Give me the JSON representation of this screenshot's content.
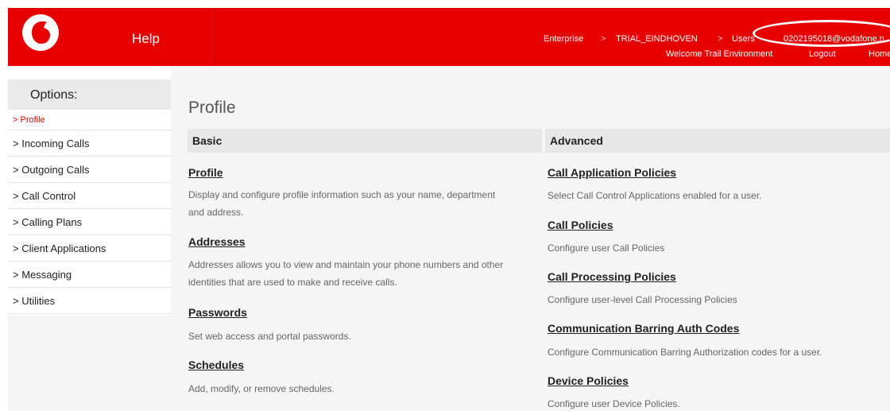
{
  "header": {
    "app_name": "Help",
    "breadcrumb": [
      "Enterprise",
      "TRIAL_EINDHOVEN",
      "Users",
      "0202195018@vodafone.n"
    ],
    "breadcrumb_sep": ">",
    "welcome": "Welcome Trail Environment",
    "logout": "Logout",
    "home": "Home",
    "brand_color": "#e60000"
  },
  "sidebar": {
    "title": "Options:",
    "items": [
      {
        "label": "> Profile",
        "active": true
      },
      {
        "label": "> Incoming Calls"
      },
      {
        "label": "> Outgoing Calls"
      },
      {
        "label": "> Call Control"
      },
      {
        "label": "> Calling Plans"
      },
      {
        "label": "> Client Applications"
      },
      {
        "label": "> Messaging"
      },
      {
        "label": "> Utilities"
      }
    ]
  },
  "main": {
    "title": "Profile",
    "basic": {
      "header": "Basic",
      "items": [
        {
          "title": "Profile",
          "desc": "Display and configure profile information such as your name, department and address."
        },
        {
          "title": "Addresses",
          "desc": "Addresses allows you to view and maintain your phone numbers and other identities that are used to make and receive calls."
        },
        {
          "title": "Passwords",
          "desc": "Set web access and portal passwords."
        },
        {
          "title": "Schedules",
          "desc": "Add, modify, or remove schedules."
        }
      ]
    },
    "advanced": {
      "header": "Advanced",
      "items": [
        {
          "title": "Call Application Policies",
          "desc": "Select Call Control Applications enabled for a user."
        },
        {
          "title": "Call Policies",
          "desc": "Configure user Call Policies"
        },
        {
          "title": "Call Processing Policies",
          "desc": "Configure user-level Call Processing Policies"
        },
        {
          "title": "Communication Barring Auth Codes",
          "desc": "Configure Communication Barring Authorization codes for a user."
        },
        {
          "title": "Device Policies",
          "desc": "Configure user Device Policies."
        }
      ]
    }
  }
}
